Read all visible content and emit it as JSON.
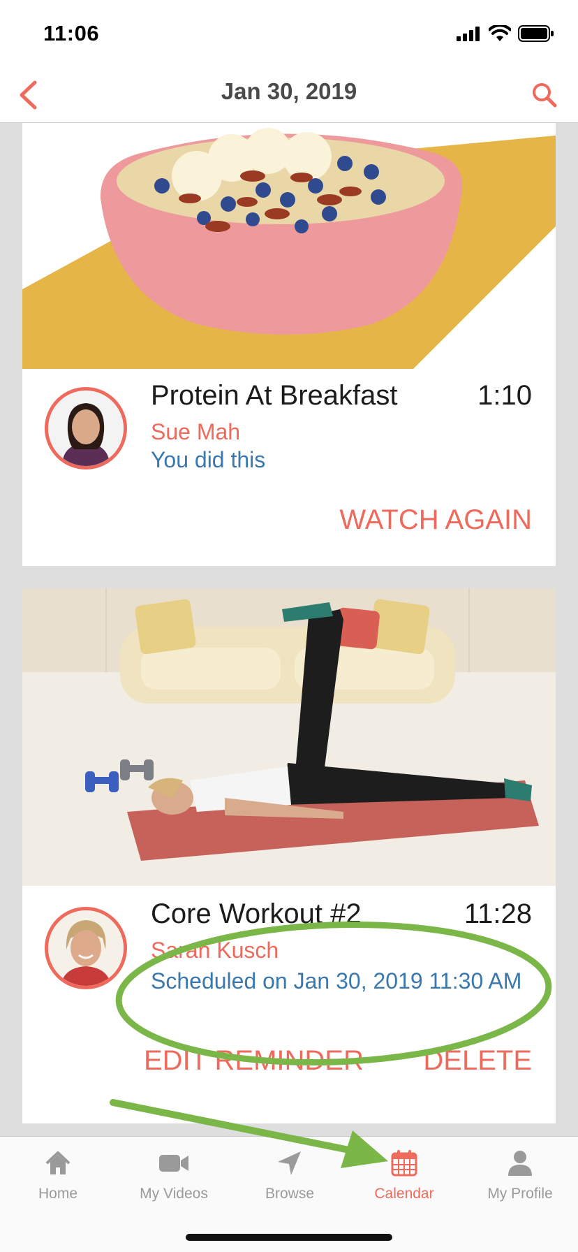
{
  "status_bar": {
    "time": "11:06"
  },
  "nav": {
    "title": "Jan 30, 2019"
  },
  "videos": [
    {
      "title": "Protein At Breakfast",
      "duration": "1:10",
      "instructor": "Sue Mah",
      "status": "You did this",
      "actions": [
        "WATCH AGAIN"
      ]
    },
    {
      "title": "Core Workout #2",
      "duration": "11:28",
      "instructor": "Sarah Kusch",
      "status": "Scheduled on Jan 30, 2019 11:30 AM",
      "actions": [
        "EDIT REMINDER",
        "DELETE"
      ]
    }
  ],
  "tabs": [
    {
      "label": "Home",
      "icon": "home-icon",
      "active": false
    },
    {
      "label": "My Videos",
      "icon": "video-camera-icon",
      "active": false
    },
    {
      "label": "Browse",
      "icon": "navigation-arrow-icon",
      "active": false
    },
    {
      "label": "Calendar",
      "icon": "calendar-icon",
      "active": true
    },
    {
      "label": "My Profile",
      "icon": "person-icon",
      "active": false
    }
  ],
  "colors": {
    "accent": "#ee6a5c",
    "status_blue": "#3a78ad",
    "annotation_green": "#7ab648",
    "tab_inactive": "#9a9a9a",
    "content_bg": "#dedede"
  }
}
